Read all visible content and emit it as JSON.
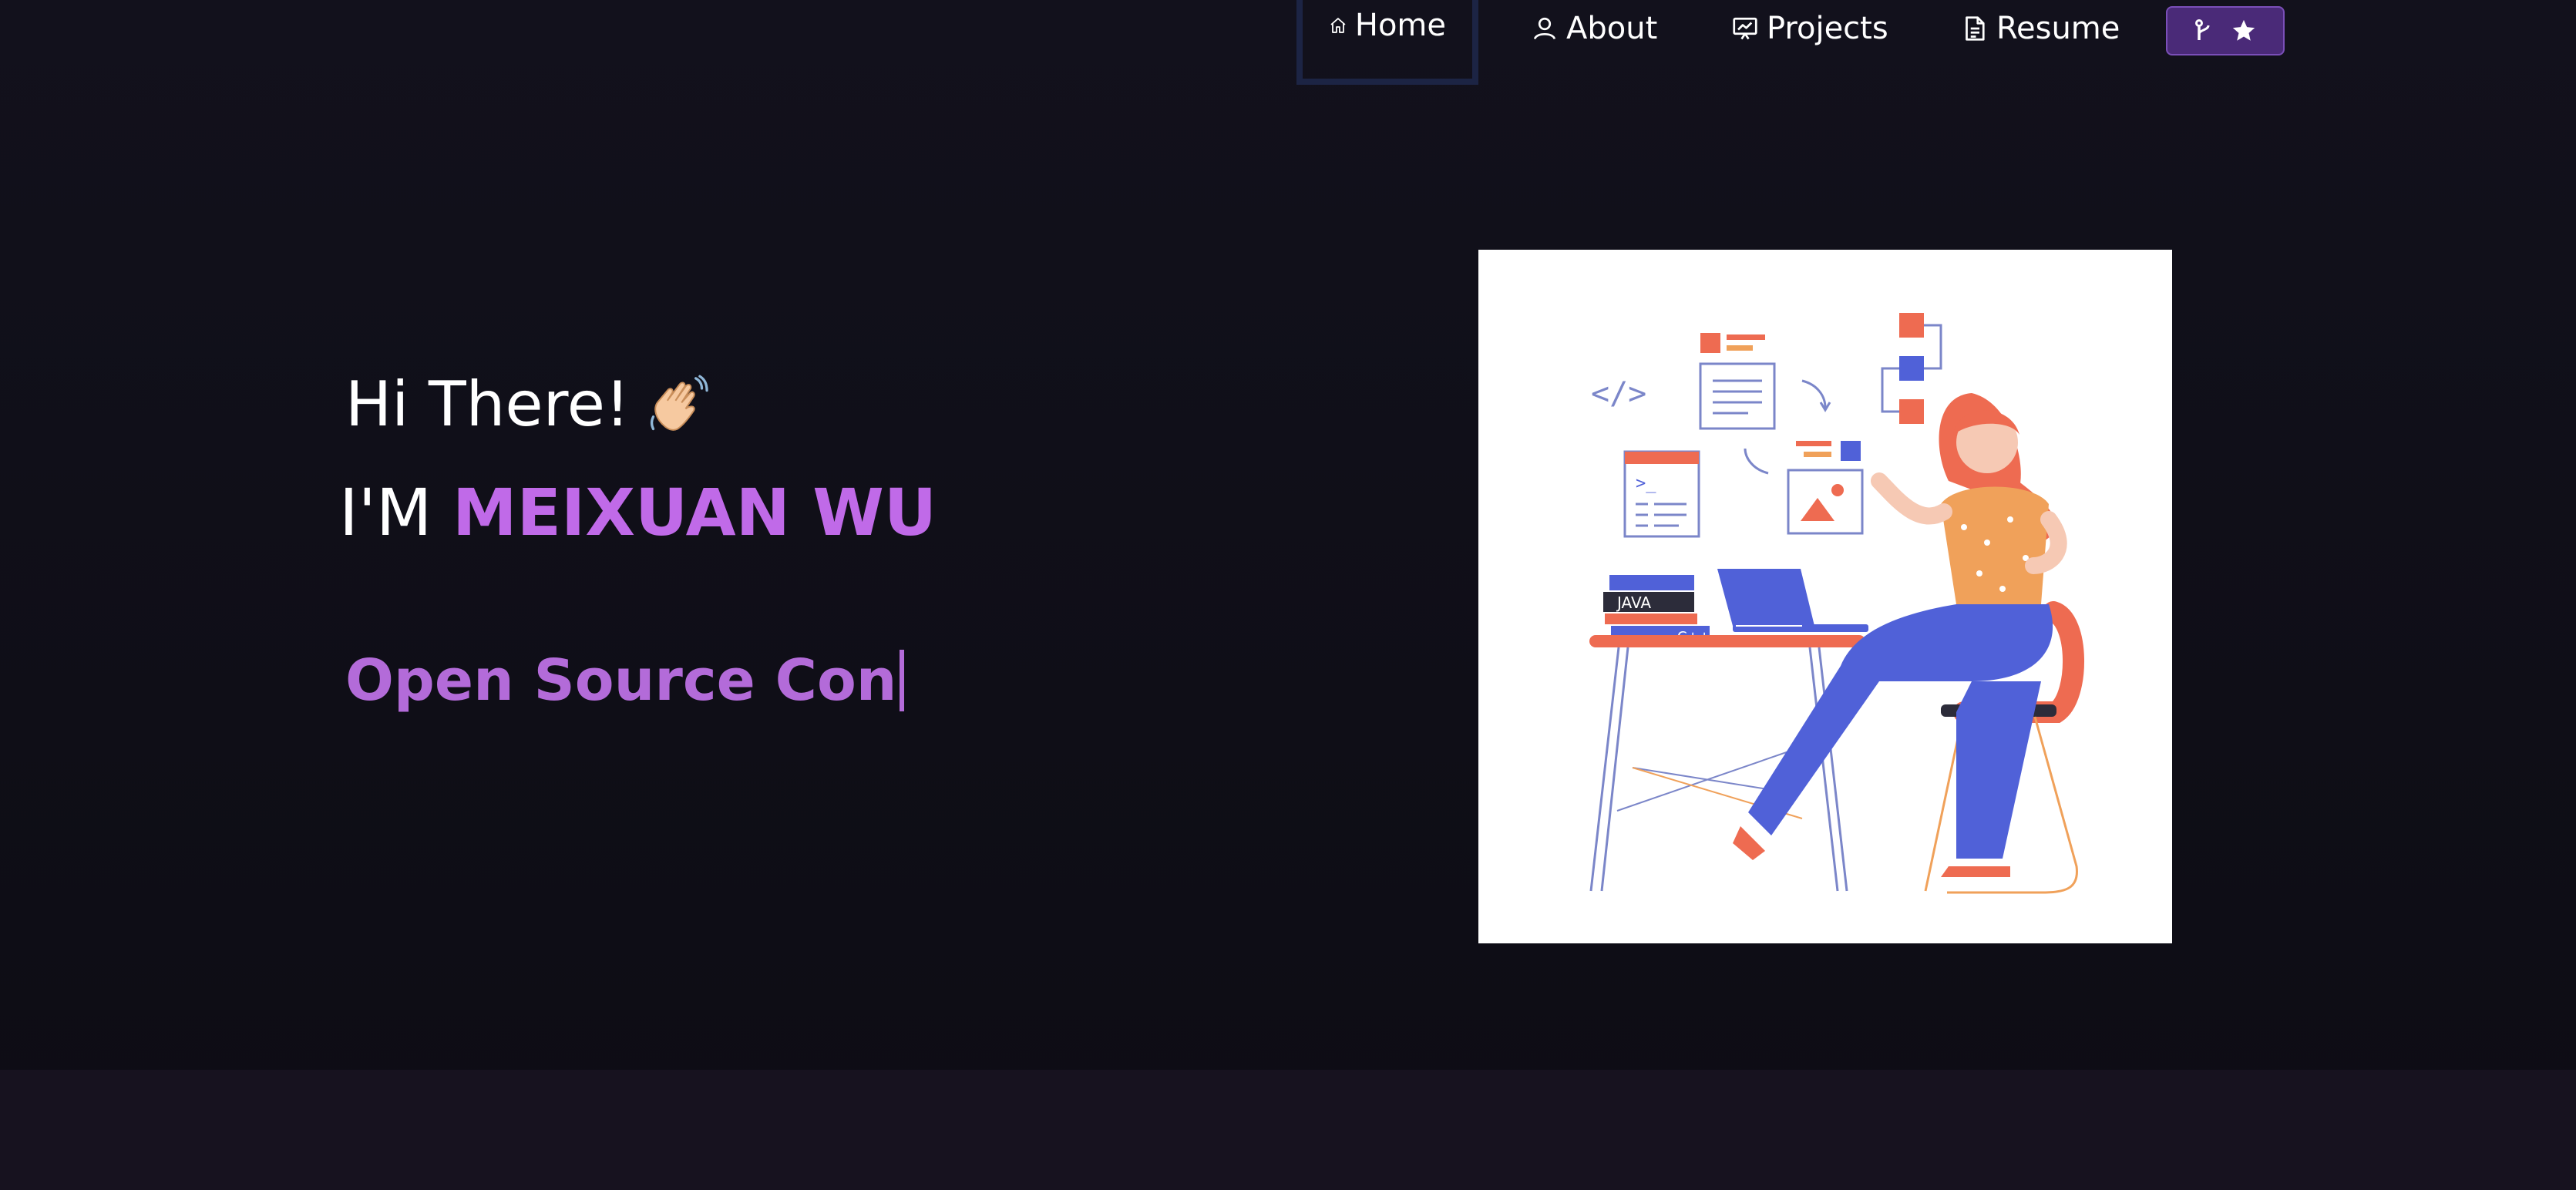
{
  "nav": {
    "items": [
      {
        "label": "Home",
        "icon": "home-icon",
        "active": true
      },
      {
        "label": "About",
        "icon": "user-icon",
        "active": false
      },
      {
        "label": "Projects",
        "icon": "presentation-icon",
        "active": false
      },
      {
        "label": "Resume",
        "icon": "document-icon",
        "active": false
      }
    ],
    "fork_button": {
      "icons": [
        "git-fork-icon",
        "star-icon"
      ]
    }
  },
  "hero": {
    "greeting": "Hi There!",
    "greeting_icon": "waving-hand-icon",
    "intro_prefix": "I'M",
    "intro_name": "MEIXUAN WU",
    "typewriter_text": "Open Source Con"
  },
  "colors": {
    "background": "#0f0e17",
    "accent": "#c06ae8",
    "typewriter": "#b36bd9",
    "fork_button_bg": "#4a2a78",
    "illustration_orange": "#ee6b51",
    "illustration_blue": "#5061d8"
  }
}
